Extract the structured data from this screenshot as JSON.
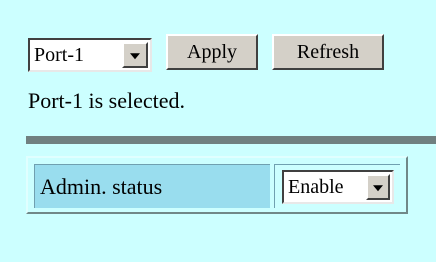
{
  "port_selector": {
    "selected": "Port-1"
  },
  "buttons": {
    "apply": "Apply",
    "refresh": "Refresh"
  },
  "status": {
    "message": "Port-1 is selected."
  },
  "table": {
    "rows": [
      {
        "label": "Admin. status",
        "value": "Enable"
      }
    ]
  }
}
